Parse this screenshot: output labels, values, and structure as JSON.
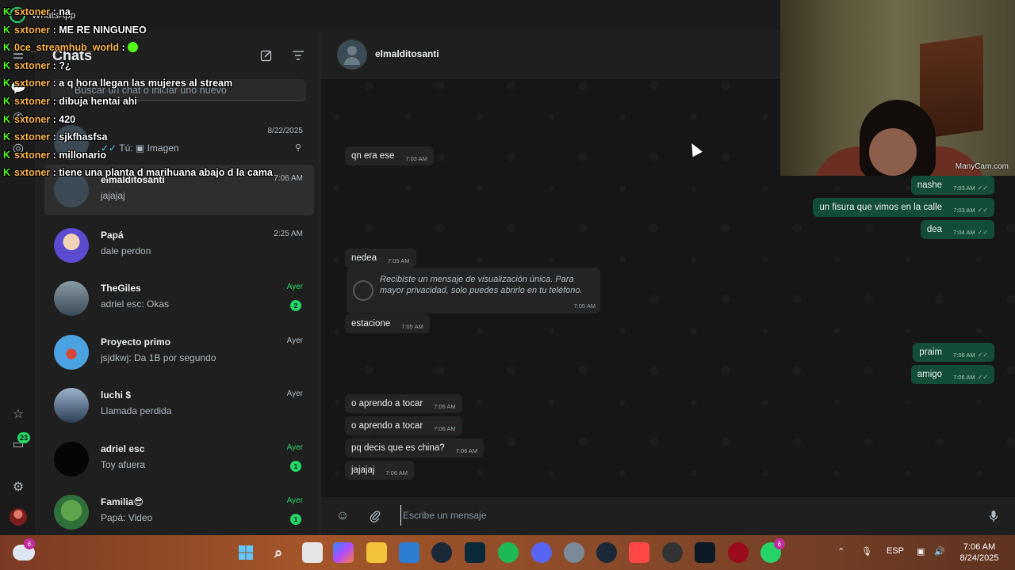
{
  "window": {
    "title": "WhatsApp"
  },
  "sidebar": {
    "title": "Chats",
    "search_placeholder": "Buscar un chat o iniciar uno nuevo",
    "rail_badge": "23",
    "chats": [
      {
        "name": "",
        "preview_prefix": "Tú:",
        "preview": "Imagen",
        "time": "8/22/2025",
        "pinned": true
      },
      {
        "name": "elmalditosanti",
        "preview": "jajajaj",
        "time": "7:06 AM",
        "active": true
      },
      {
        "name": "Papá",
        "preview": "dale perdon",
        "time": "2:25 AM"
      },
      {
        "name": "TheGiles",
        "preview": "adriel esc: Okas",
        "time": "Ayer",
        "unread": "2"
      },
      {
        "name": "Proyecto primo",
        "preview": "jsjdkwj: Da 1B por segundo",
        "time": "Ayer"
      },
      {
        "name": "luchi $",
        "preview": "Llamada perdida",
        "time": "Ayer"
      },
      {
        "name": "adriel esc",
        "preview": "Toy afuera",
        "time": "Ayer",
        "unread": "1"
      },
      {
        "name": "Familia😎",
        "preview": "Papá: Video",
        "time": "Ayer",
        "unread": "1"
      }
    ]
  },
  "conversation": {
    "contact": "elmalditosanti",
    "view_once_text": "Recibiste un mensaje de visualización única. Para mayor privacidad, solo puedes abrirlo en tu teléfono.",
    "view_once_time": "7:05 AM",
    "messages": [
      {
        "text": "qn era ese",
        "time": "7:03 AM",
        "dir": "in"
      },
      {
        "text": "nashe",
        "time": "7:03 AM",
        "dir": "out"
      },
      {
        "text": "un fisura que vimos en la calle",
        "time": "7:03 AM",
        "dir": "out"
      },
      {
        "text": "dea",
        "time": "7:04 AM",
        "dir": "out"
      },
      {
        "text": "nedea",
        "time": "7:05 AM",
        "dir": "in"
      },
      {
        "text": "estacione",
        "time": "7:05 AM",
        "dir": "in"
      },
      {
        "text": "praim",
        "time": "7:06 AM",
        "dir": "out"
      },
      {
        "text": "amigo",
        "time": "7:06 AM",
        "dir": "out"
      },
      {
        "text": "o aprendo a tocar",
        "time": "7:06 AM",
        "dir": "in"
      },
      {
        "text": "o aprendo a tocar",
        "time": "7:06 AM",
        "dir": "in"
      },
      {
        "text": "pq decis que es china?",
        "time": "7:06 AM",
        "dir": "in"
      },
      {
        "text": "jajajaj",
        "time": "7:06 AM",
        "dir": "in"
      }
    ],
    "composer_placeholder": "Escribe un mensaje"
  },
  "webcam": {
    "watermark": "ManyCam.com"
  },
  "stream_chat": [
    {
      "user": "sxtoner",
      "text": "na"
    },
    {
      "user": "sxtoner",
      "text": "ME RE NINGUNEO"
    },
    {
      "user": "0ce_streamhub_world",
      "text": ""
    },
    {
      "user": "sxtoner",
      "text": "?¿"
    },
    {
      "user": "sxtoner",
      "text": "a q hora llegan las mujeres al stream"
    },
    {
      "user": "sxtoner",
      "text": "dibuja hentai ahi"
    },
    {
      "user": "sxtoner",
      "text": "420"
    },
    {
      "user": "sxtoner",
      "text": "sjkfhasfsa"
    },
    {
      "user": "sxtoner",
      "text": "millonario"
    },
    {
      "user": "sxtoner",
      "text": "tiene una planta d marihuana abajo d la cama"
    }
  ],
  "taskbar": {
    "weather_badge": "6",
    "whatsapp_badge": "6",
    "language": "ESP",
    "time": "7:06 AM",
    "date": "8/24/2025"
  }
}
